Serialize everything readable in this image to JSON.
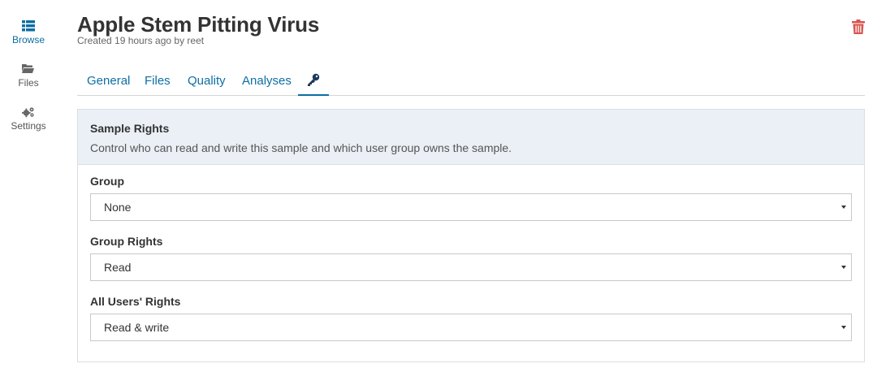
{
  "sidebar": {
    "items": [
      {
        "label": "Browse",
        "icon": "list-icon"
      },
      {
        "label": "Files",
        "icon": "folder-icon"
      },
      {
        "label": "Settings",
        "icon": "gears-icon"
      }
    ]
  },
  "header": {
    "title": "Apple Stem Pitting Virus",
    "subtitle": "Created 19 hours ago by reet"
  },
  "tabs": [
    {
      "label": "General"
    },
    {
      "label": "Files"
    },
    {
      "label": "Quality"
    },
    {
      "label": "Analyses"
    },
    {
      "label": "",
      "icon": "key-icon",
      "active": true
    }
  ],
  "rights": {
    "title": "Sample Rights",
    "description": "Control who can read and write this sample and which user group owns the sample.",
    "fields": [
      {
        "label": "Group",
        "value": "None"
      },
      {
        "label": "Group Rights",
        "value": "Read"
      },
      {
        "label": "All Users' Rights",
        "value": "Read & write"
      }
    ]
  },
  "colors": {
    "accent": "#0d6ea3",
    "danger": "#d9534f",
    "panel_header_bg": "#eaf0f5"
  }
}
